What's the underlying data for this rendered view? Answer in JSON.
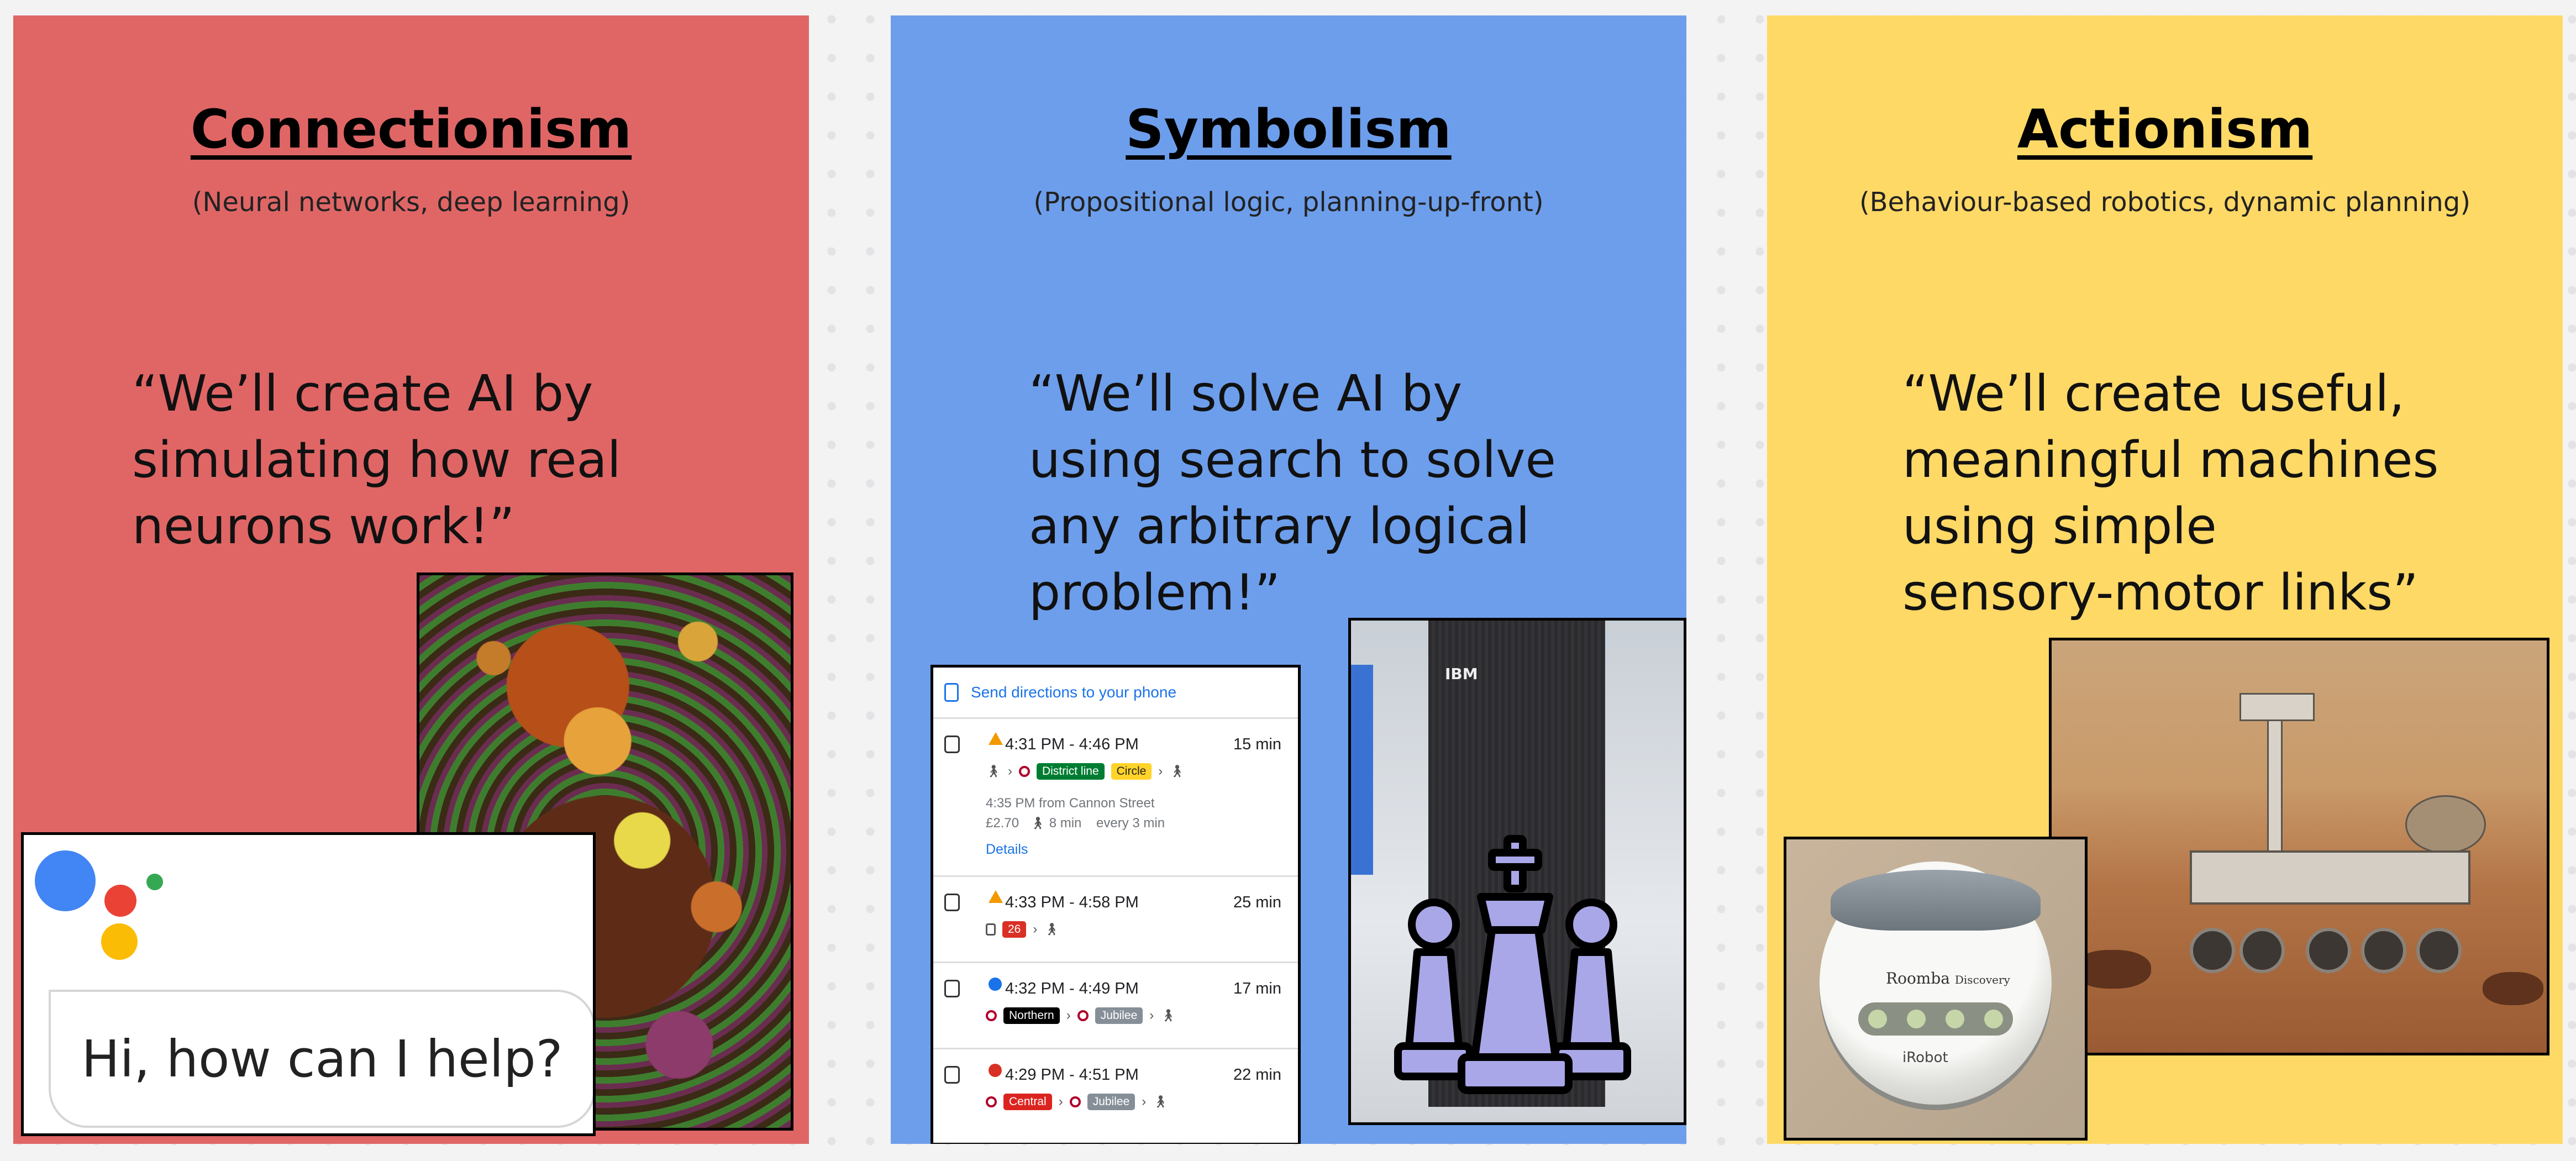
{
  "panels": [
    {
      "title": "Connectionism",
      "subtitle": "(Neural networks, deep learning)",
      "quote": "“We’ll create AI by\nsimulating how real\nneurons work!”",
      "background": "#e06666",
      "assistant_prompt": "Hi, how can I help?"
    },
    {
      "title": "Symbolism",
      "subtitle": "(Propositional logic, planning-up-front)",
      "quote": "“We’ll solve AI by\nusing search to solve\nany arbitrary logical\nproblem!”",
      "background": "#6d9eeb",
      "maps": {
        "header": "Send directions to your phone",
        "routes": [
          {
            "time": "4:31 PM - 4:46 PM",
            "duration": "15 min",
            "line1": "District line",
            "line2": "Circle",
            "detail1": "4:35 PM from Cannon Street",
            "fare": "£2.70",
            "walk": "8 min",
            "frequency": "every 3 min",
            "link": "Details"
          },
          {
            "time": "4:33 PM - 4:58 PM",
            "duration": "25 min",
            "bus": "26"
          },
          {
            "time": "4:32 PM - 4:49 PM",
            "duration": "17 min",
            "line1": "Northern",
            "line2": "Jubilee"
          },
          {
            "time": "4:29 PM - 4:51 PM",
            "duration": "22 min",
            "line1": "Central",
            "line2": "Jubilee"
          }
        ]
      },
      "deep_blue_label": "IBM"
    },
    {
      "title": "Actionism",
      "subtitle": "(Behaviour-based robotics, dynamic planning)",
      "quote": "“We’ll create useful,\nmeaningful machines\nusing simple\nsensory-motor links”",
      "background": "#ffd966",
      "roomba_brand": "Roomba",
      "roomba_model": "Discovery",
      "roomba_maker": "iRobot"
    }
  ]
}
